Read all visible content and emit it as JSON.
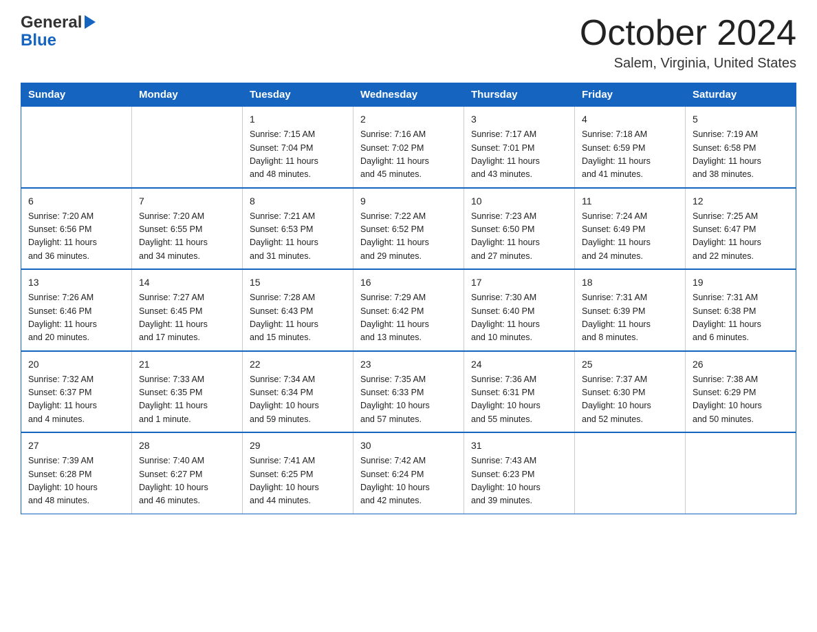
{
  "header": {
    "logo_line1_general": "General",
    "logo_line2_blue": "Blue",
    "month_title": "October 2024",
    "location": "Salem, Virginia, United States"
  },
  "days_of_week": [
    "Sunday",
    "Monday",
    "Tuesday",
    "Wednesday",
    "Thursday",
    "Friday",
    "Saturday"
  ],
  "weeks": [
    [
      {
        "day": "",
        "info": ""
      },
      {
        "day": "",
        "info": ""
      },
      {
        "day": "1",
        "info": "Sunrise: 7:15 AM\nSunset: 7:04 PM\nDaylight: 11 hours\nand 48 minutes."
      },
      {
        "day": "2",
        "info": "Sunrise: 7:16 AM\nSunset: 7:02 PM\nDaylight: 11 hours\nand 45 minutes."
      },
      {
        "day": "3",
        "info": "Sunrise: 7:17 AM\nSunset: 7:01 PM\nDaylight: 11 hours\nand 43 minutes."
      },
      {
        "day": "4",
        "info": "Sunrise: 7:18 AM\nSunset: 6:59 PM\nDaylight: 11 hours\nand 41 minutes."
      },
      {
        "day": "5",
        "info": "Sunrise: 7:19 AM\nSunset: 6:58 PM\nDaylight: 11 hours\nand 38 minutes."
      }
    ],
    [
      {
        "day": "6",
        "info": "Sunrise: 7:20 AM\nSunset: 6:56 PM\nDaylight: 11 hours\nand 36 minutes."
      },
      {
        "day": "7",
        "info": "Sunrise: 7:20 AM\nSunset: 6:55 PM\nDaylight: 11 hours\nand 34 minutes."
      },
      {
        "day": "8",
        "info": "Sunrise: 7:21 AM\nSunset: 6:53 PM\nDaylight: 11 hours\nand 31 minutes."
      },
      {
        "day": "9",
        "info": "Sunrise: 7:22 AM\nSunset: 6:52 PM\nDaylight: 11 hours\nand 29 minutes."
      },
      {
        "day": "10",
        "info": "Sunrise: 7:23 AM\nSunset: 6:50 PM\nDaylight: 11 hours\nand 27 minutes."
      },
      {
        "day": "11",
        "info": "Sunrise: 7:24 AM\nSunset: 6:49 PM\nDaylight: 11 hours\nand 24 minutes."
      },
      {
        "day": "12",
        "info": "Sunrise: 7:25 AM\nSunset: 6:47 PM\nDaylight: 11 hours\nand 22 minutes."
      }
    ],
    [
      {
        "day": "13",
        "info": "Sunrise: 7:26 AM\nSunset: 6:46 PM\nDaylight: 11 hours\nand 20 minutes."
      },
      {
        "day": "14",
        "info": "Sunrise: 7:27 AM\nSunset: 6:45 PM\nDaylight: 11 hours\nand 17 minutes."
      },
      {
        "day": "15",
        "info": "Sunrise: 7:28 AM\nSunset: 6:43 PM\nDaylight: 11 hours\nand 15 minutes."
      },
      {
        "day": "16",
        "info": "Sunrise: 7:29 AM\nSunset: 6:42 PM\nDaylight: 11 hours\nand 13 minutes."
      },
      {
        "day": "17",
        "info": "Sunrise: 7:30 AM\nSunset: 6:40 PM\nDaylight: 11 hours\nand 10 minutes."
      },
      {
        "day": "18",
        "info": "Sunrise: 7:31 AM\nSunset: 6:39 PM\nDaylight: 11 hours\nand 8 minutes."
      },
      {
        "day": "19",
        "info": "Sunrise: 7:31 AM\nSunset: 6:38 PM\nDaylight: 11 hours\nand 6 minutes."
      }
    ],
    [
      {
        "day": "20",
        "info": "Sunrise: 7:32 AM\nSunset: 6:37 PM\nDaylight: 11 hours\nand 4 minutes."
      },
      {
        "day": "21",
        "info": "Sunrise: 7:33 AM\nSunset: 6:35 PM\nDaylight: 11 hours\nand 1 minute."
      },
      {
        "day": "22",
        "info": "Sunrise: 7:34 AM\nSunset: 6:34 PM\nDaylight: 10 hours\nand 59 minutes."
      },
      {
        "day": "23",
        "info": "Sunrise: 7:35 AM\nSunset: 6:33 PM\nDaylight: 10 hours\nand 57 minutes."
      },
      {
        "day": "24",
        "info": "Sunrise: 7:36 AM\nSunset: 6:31 PM\nDaylight: 10 hours\nand 55 minutes."
      },
      {
        "day": "25",
        "info": "Sunrise: 7:37 AM\nSunset: 6:30 PM\nDaylight: 10 hours\nand 52 minutes."
      },
      {
        "day": "26",
        "info": "Sunrise: 7:38 AM\nSunset: 6:29 PM\nDaylight: 10 hours\nand 50 minutes."
      }
    ],
    [
      {
        "day": "27",
        "info": "Sunrise: 7:39 AM\nSunset: 6:28 PM\nDaylight: 10 hours\nand 48 minutes."
      },
      {
        "day": "28",
        "info": "Sunrise: 7:40 AM\nSunset: 6:27 PM\nDaylight: 10 hours\nand 46 minutes."
      },
      {
        "day": "29",
        "info": "Sunrise: 7:41 AM\nSunset: 6:25 PM\nDaylight: 10 hours\nand 44 minutes."
      },
      {
        "day": "30",
        "info": "Sunrise: 7:42 AM\nSunset: 6:24 PM\nDaylight: 10 hours\nand 42 minutes."
      },
      {
        "day": "31",
        "info": "Sunrise: 7:43 AM\nSunset: 6:23 PM\nDaylight: 10 hours\nand 39 minutes."
      },
      {
        "day": "",
        "info": ""
      },
      {
        "day": "",
        "info": ""
      }
    ]
  ]
}
